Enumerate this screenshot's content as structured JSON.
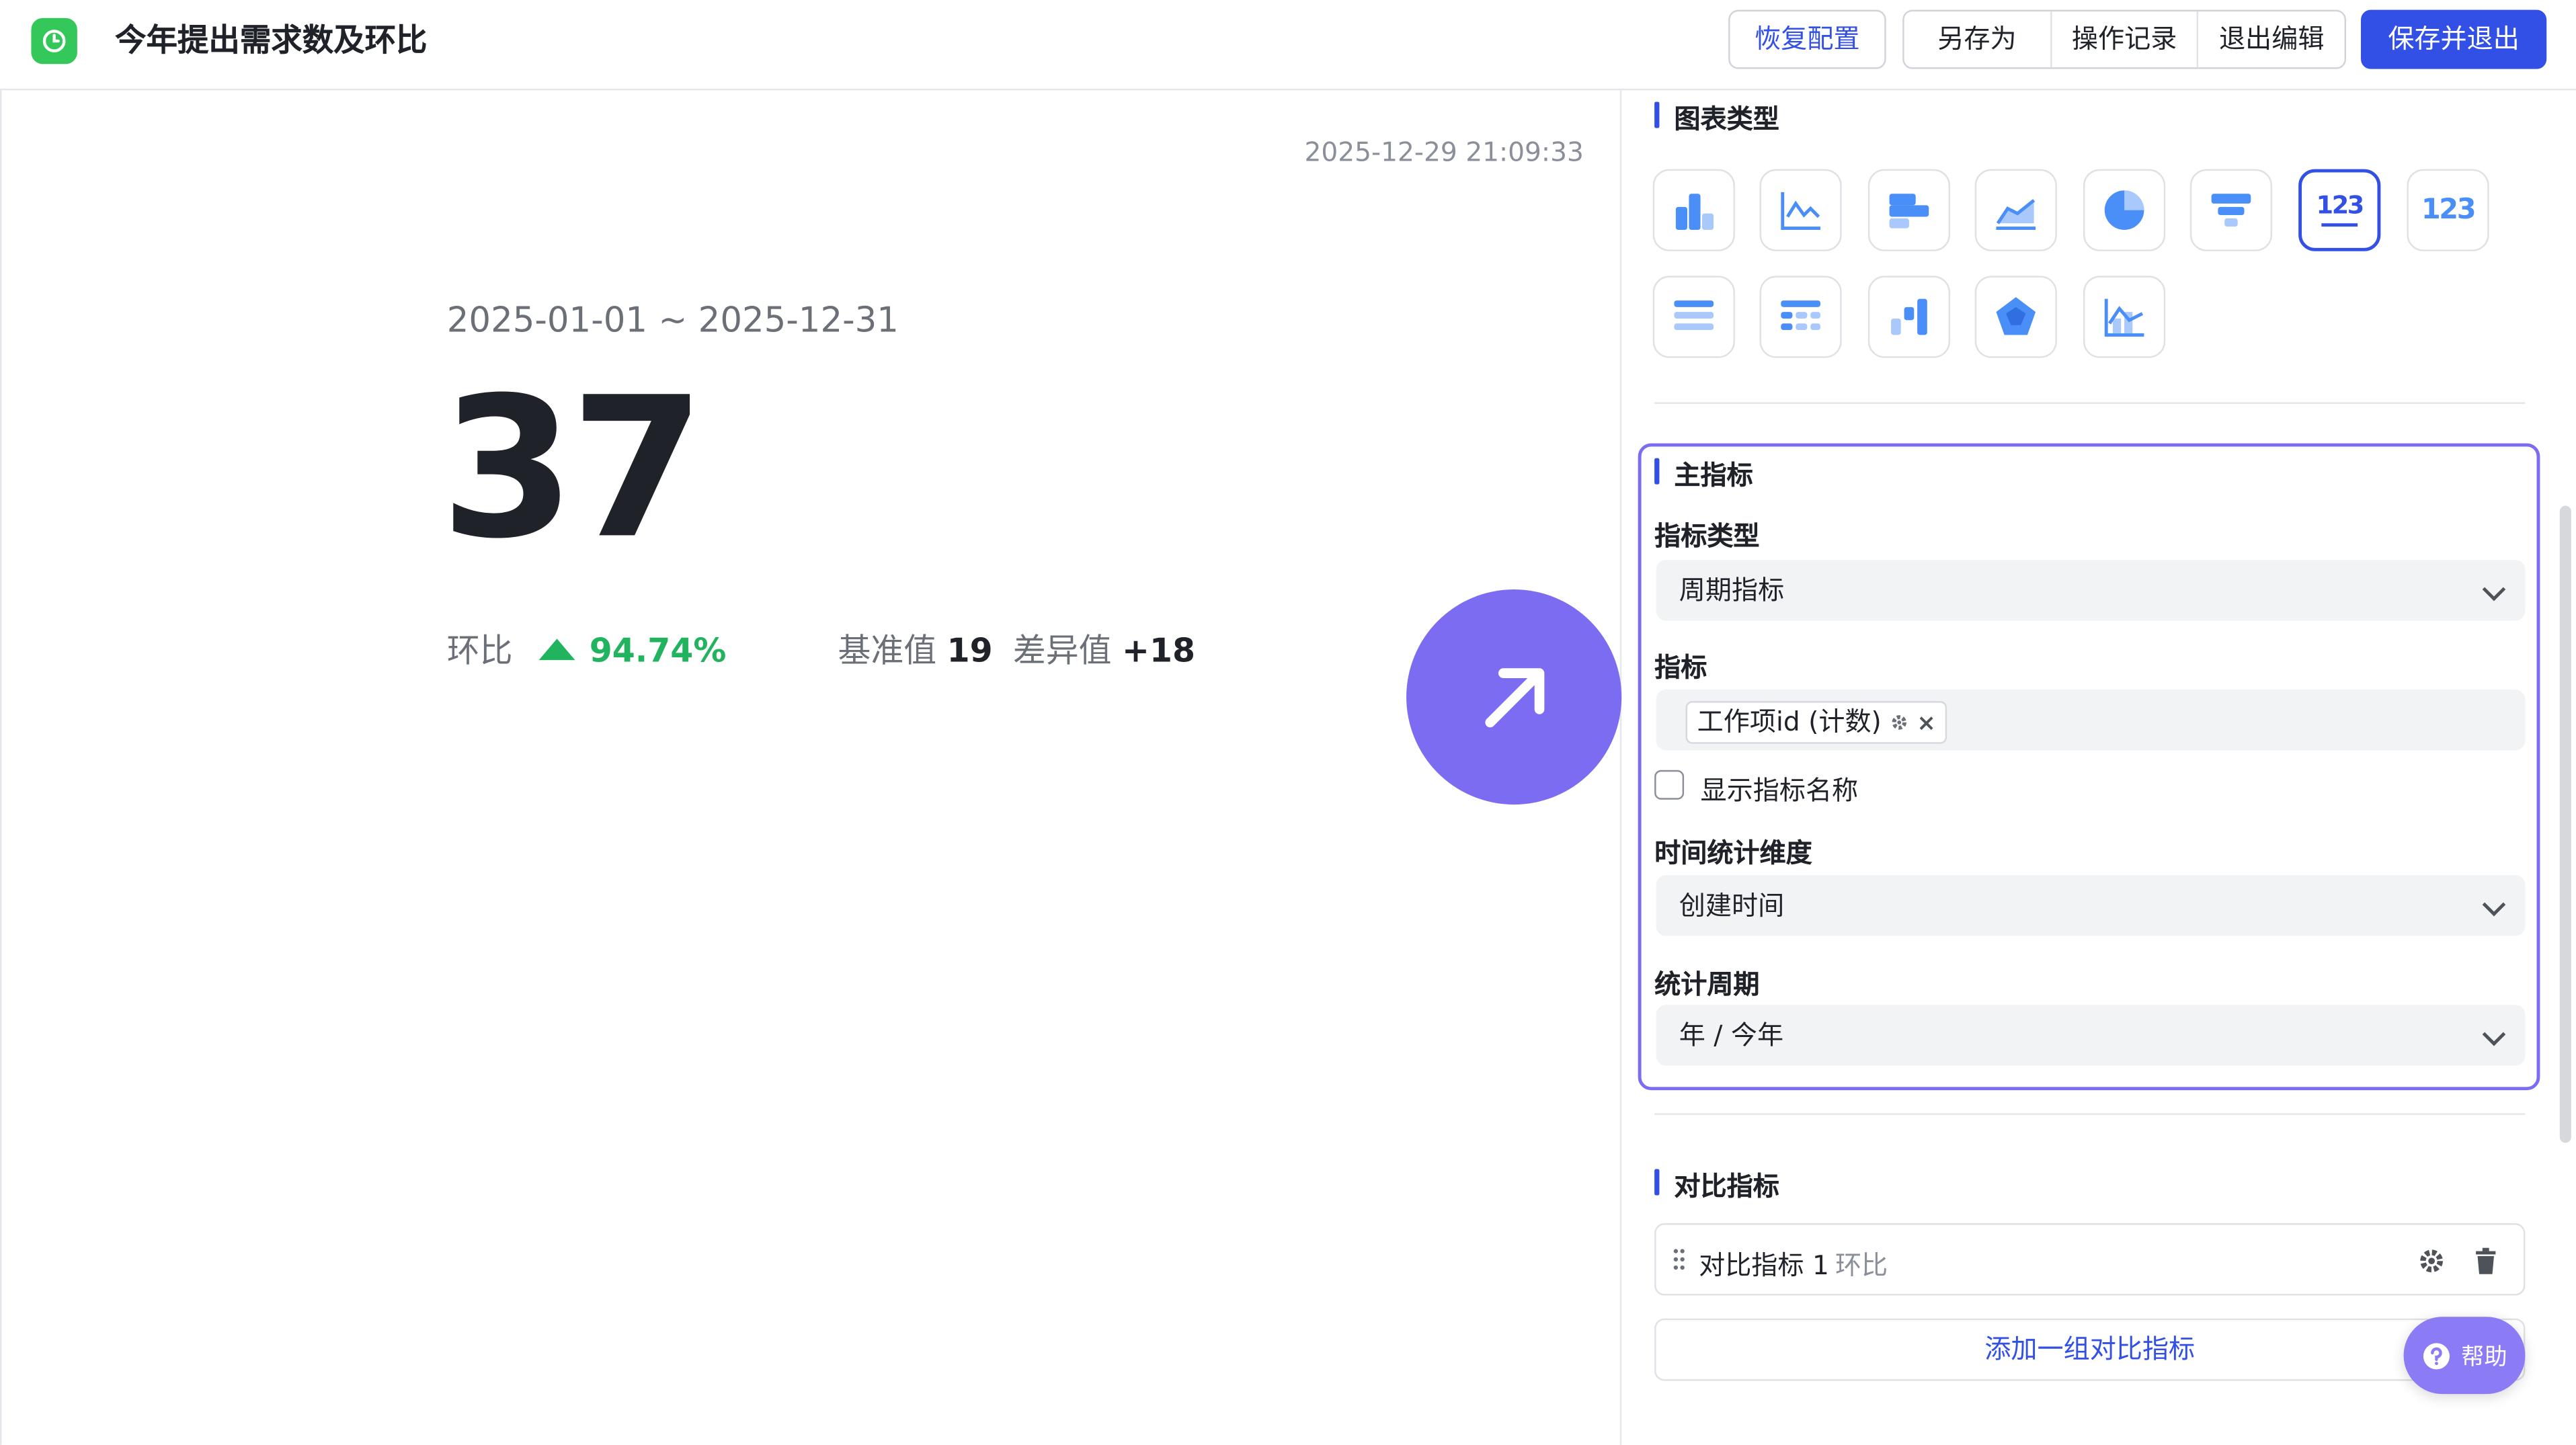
{
  "header": {
    "title": "今年提出需求数及环比",
    "restore_label": "恢复配置",
    "save_as_label": "另存为",
    "history_label": "操作记录",
    "exit_edit_label": "退出编辑",
    "save_exit_label": "保存并退出"
  },
  "card": {
    "timestamp": "2025-12-29 21:09:33",
    "date_range": "2025-01-01 ~ 2025-12-31",
    "value": "37",
    "mom_label": "环比",
    "mom_value": "94.74%",
    "baseline_label": "基准值",
    "baseline_value": "19",
    "diff_label": "差异值",
    "diff_value": "+18"
  },
  "chart_type": {
    "heading": "图表类型",
    "types": [
      {
        "icon": "bar-chart-icon"
      },
      {
        "icon": "line-chart-icon"
      },
      {
        "icon": "horizontal-bar-icon"
      },
      {
        "icon": "area-chart-icon"
      },
      {
        "icon": "pie-chart-icon"
      },
      {
        "icon": "funnel-chart-icon"
      },
      {
        "icon": "metric-card-icon",
        "text": "123",
        "selected": true
      },
      {
        "icon": "number-icon",
        "text": "123"
      },
      {
        "icon": "list-table-icon"
      },
      {
        "icon": "pivot-table-icon"
      },
      {
        "icon": "waterfall-icon"
      },
      {
        "icon": "radar-chart-icon"
      },
      {
        "icon": "combo-chart-icon"
      }
    ]
  },
  "main_metric": {
    "heading": "主指标",
    "metric_type_label": "指标类型",
    "metric_type_value": "周期指标",
    "metric_label": "指标",
    "metric_tag": "工作项id (计数)",
    "show_name_label": "显示指标名称",
    "time_dim_label": "时间统计维度",
    "time_dim_value": "创建时间",
    "period_label": "统计周期",
    "period_value": "年 / 今年"
  },
  "compare_metric": {
    "heading": "对比指标",
    "item_name": "对比指标 1",
    "item_type": "环比",
    "add_label": "添加一组对比指标"
  },
  "help_label": "帮助",
  "colors": {
    "primary": "#3250e6",
    "accent": "#7b6cf2",
    "up": "#22b35e",
    "app_icon": "#34c759"
  }
}
